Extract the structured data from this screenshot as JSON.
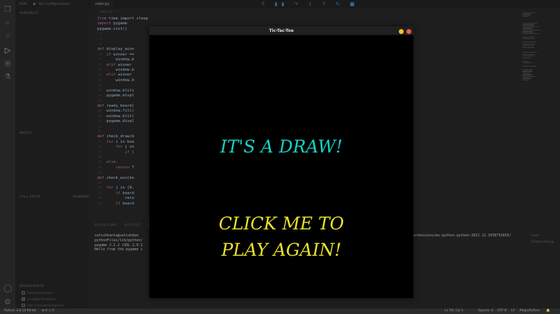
{
  "vscode": {
    "run_label": "RUN",
    "run_config": "No Configurations",
    "sidebar_variables": "VARIABLES",
    "sidebar_watch": "WATCH",
    "sidebar_callstack": "CALL STACK",
    "sidebar_callstack_status": "RUNNING",
    "sidebar_breakpoints": "BREAKPOINTS",
    "breakpoint_options": [
      {
        "label": "Raised Exceptions",
        "checked": false
      },
      {
        "label": "Uncaught Exceptions",
        "checked": true
      },
      {
        "label": "User Uncaught Exceptions",
        "checked": false
      }
    ],
    "tab_label": "main.py",
    "breadcrumb": "main.py > ...",
    "code_lines": [
      "from time import sleep",
      "import pygame",
      "pygame.init()",
      "",
      "",
      "",
      "def display_winn",
      "    if winner ==",
      "        window.b",
      "    elif winner",
      "        window.b",
      "    elif winner",
      "        window.b",
      "",
      "    window.bliti",
      "    pygame.displ",
      "",
      "def ready_board(",
      "    window.fill(",
      "    window.blit(",
      "    pygame.displ",
      "",
      "",
      "def check_draw(b",
      "    for i in boa",
      "        for j in",
      "            if (",
      "",
      "    else:",
      "        return T",
      "",
      "def check_win(bo",
      "",
      "    for j in [0,",
      "        if board",
      "            retu",
      "        if board"
    ],
    "panel_tabs": [
      "PROBLEMS",
      "OUTPUT",
      "DEBUG CONSOLE",
      "TERMINAL"
    ],
    "terminal_lines": [
      "satishbanta@satishdun",
      "pythonFiles/lib/python/",
      "pygame 2.1.2 (SDL 2.0.1",
      "Hello from the pygame c"
    ],
    "terminal_right": "extensions/ms-python.python-2021.12.1559732655/",
    "terminal_side": [
      "bash",
      "Python Debug"
    ],
    "status": {
      "python_version": "Python 3.8.10 64-bit",
      "errors": "⊗ 0 ⚠ 0",
      "cursor": "Ln 56, Col 1",
      "spaces": "Spaces: 4",
      "encoding": "UTF-8",
      "eol": "LF",
      "language": "MagicPython"
    }
  },
  "game": {
    "window_title": "Tic-Tac-Toe",
    "result_message": "IT'S A DRAW!",
    "play_again_line1": "CLICK ME TO",
    "play_again_line2": "PLAY AGAIN!",
    "colors": {
      "result": "#17d1c1",
      "play_again": "#e9e22a",
      "background": "#000000",
      "minimize": "#f5c127",
      "close": "#ef5a4c"
    }
  }
}
